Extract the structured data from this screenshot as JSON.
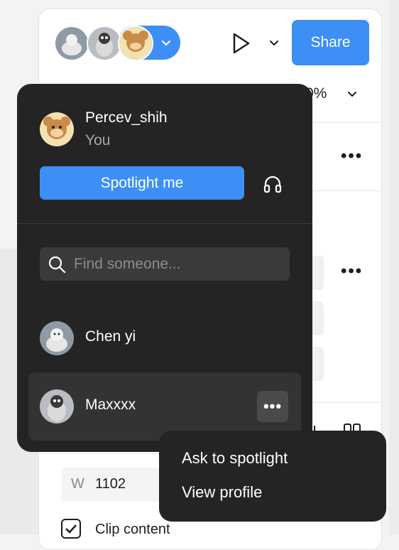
{
  "toolbar": {
    "share_label": "Share",
    "zoom_text": "0%",
    "play_icon": "play-icon",
    "accent": "#3d8ff5"
  },
  "properties": {
    "w_label": "W",
    "w_value": "1102",
    "clip_label": "Clip content"
  },
  "popover": {
    "me": {
      "name": "Percev_shih",
      "subtitle": "You"
    },
    "spotlight_label": "Spotlight me",
    "search": {
      "placeholder": "Find someone...",
      "value": ""
    },
    "people": [
      {
        "name": "Chen yi",
        "more_label": "•••"
      },
      {
        "name": "Maxxxx",
        "more_label": "•••"
      }
    ]
  },
  "context_menu": {
    "items": [
      "Ask to spotlight",
      "View profile"
    ]
  },
  "misc": {
    "more_dots": "•••"
  }
}
